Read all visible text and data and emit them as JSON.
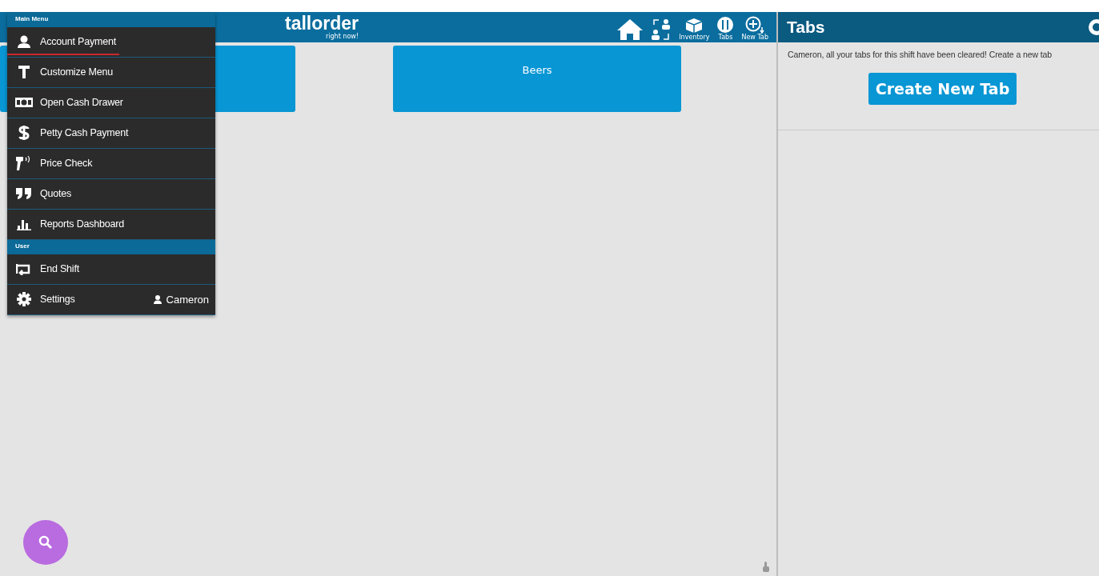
{
  "header": {
    "logo": "tallorder",
    "tagline": "right now!",
    "nav": [
      {
        "kind": "home"
      },
      {
        "kind": "transfer"
      },
      {
        "kind": "inventory",
        "label": "Inventory"
      },
      {
        "kind": "tabs",
        "label": "Tabs"
      },
      {
        "kind": "new-tab",
        "label": "New Tab"
      }
    ]
  },
  "category_tiles": [
    {
      "kind": "blank"
    },
    {
      "kind": "labeled",
      "label": "Beers"
    }
  ],
  "main_menu": {
    "title": "Main Menu",
    "items": [
      {
        "kind": "person",
        "label": "Account Payment",
        "selected": true
      },
      {
        "kind": "text",
        "label": "Customize Menu",
        "selected": false
      },
      {
        "kind": "cash",
        "label": "Open Cash Drawer",
        "selected": false
      },
      {
        "kind": "dollar",
        "label": "Petty Cash Payment",
        "selected": false
      },
      {
        "kind": "scanner",
        "label": "Price Check",
        "selected": false
      },
      {
        "kind": "quote",
        "label": "Quotes",
        "selected": false
      },
      {
        "kind": "chart",
        "label": "Reports Dashboard",
        "selected": false
      }
    ]
  },
  "user_menu": {
    "title": "User",
    "items": [
      {
        "kind": "exit",
        "label": "End Shift",
        "selected": false
      },
      {
        "kind": "gear",
        "label": "Settings",
        "selected": false,
        "user": "Cameron"
      }
    ]
  },
  "tabs_panel": {
    "title": "Tabs",
    "message": "Cameron, all your tabs for this shift have been cleared! Create a new tab",
    "button": "Create New Tab"
  }
}
